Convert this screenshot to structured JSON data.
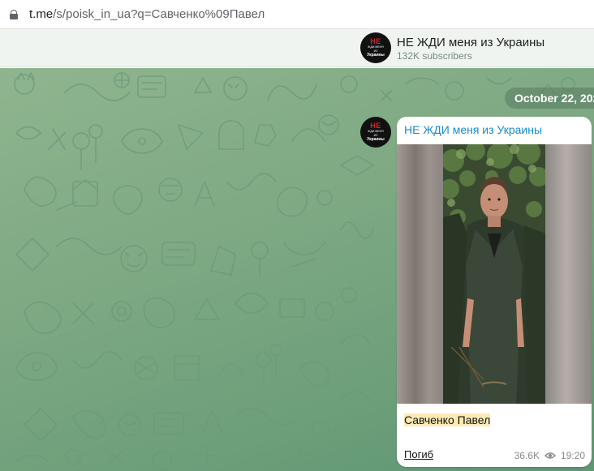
{
  "browser": {
    "url_host": "t.me",
    "url_path": "/s/poisk_in_ua?q=Савченко%09Павел"
  },
  "channel": {
    "name": "НЕ ЖДИ меня из Украины",
    "subscribers": "132K subscribers",
    "avatar": {
      "line1": "НЕ",
      "line2": "ЖДИ МЕНЯ",
      "line3": "ИЗ",
      "line4": "Украины"
    }
  },
  "chat": {
    "date_badge": "October 22, 202",
    "message": {
      "author": "НЕ ЖДИ меня из Украины",
      "caption": "Савченко Павел",
      "link_text": "Погиб",
      "views": "36.6K",
      "time": "19:20"
    }
  },
  "colors": {
    "accent_link": "#168acd",
    "highlight": "#ffeab3",
    "chat_bg": "#7ea983"
  },
  "icons": [
    "lock-icon",
    "eye-icon"
  ]
}
